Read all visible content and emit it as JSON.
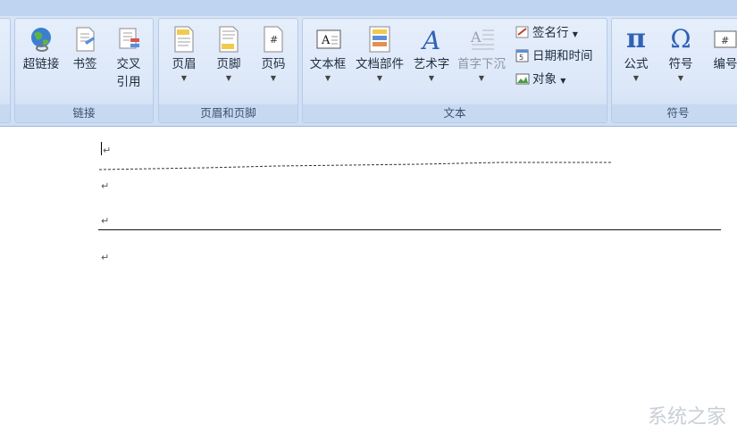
{
  "groups": {
    "links": {
      "label": "链接",
      "hyperlink": "超链接",
      "bookmark": "书签",
      "crossref_line1": "交叉",
      "crossref_line2": "引用"
    },
    "header_footer": {
      "label": "页眉和页脚",
      "header": "页眉",
      "footer": "页脚",
      "page_number": "页码"
    },
    "text": {
      "label": "文本",
      "textbox": "文本框",
      "quick_parts": "文档部件",
      "wordart": "艺术字",
      "drop_cap": "首字下沉",
      "signature_line": "签名行",
      "date_time": "日期和时间",
      "object": "对象"
    },
    "symbols": {
      "label": "符号",
      "equation": "公式",
      "symbol": "符号",
      "numbering": "编号",
      "equation_glyph": "π",
      "symbol_glyph": "Ω",
      "numbering_glyph": "#"
    }
  },
  "document": {
    "paragraph_mark": "↵"
  },
  "watermark": "系统之家",
  "colors": {
    "ribbon": "#d9e6f7",
    "group_label_bg": "#c6d9f1",
    "accent_blue": "#1f5fbf"
  }
}
